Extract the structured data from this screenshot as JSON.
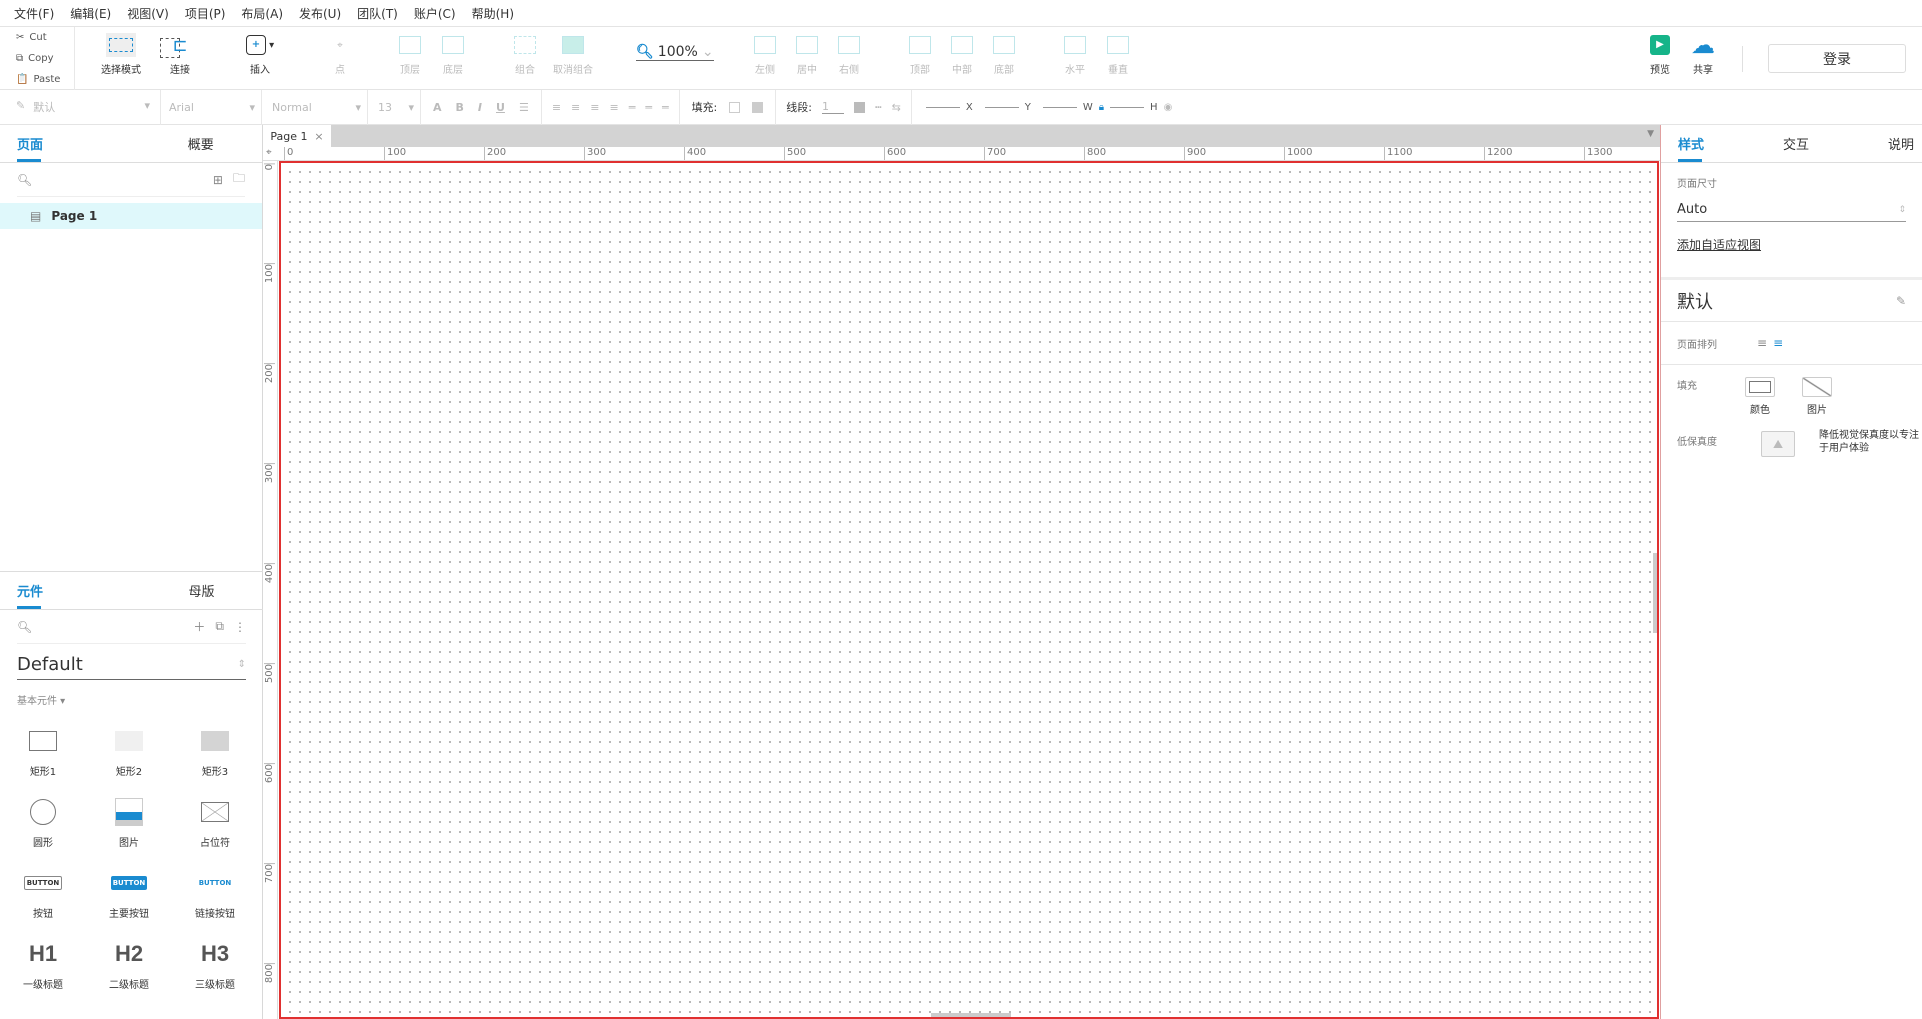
{
  "menu": [
    "文件(F)",
    "编辑(E)",
    "视图(V)",
    "项目(P)",
    "布局(A)",
    "发布(U)",
    "团队(T)",
    "账户(C)",
    "帮助(H)"
  ],
  "clipboard": {
    "cut": "Cut",
    "copy": "Copy",
    "paste": "Paste"
  },
  "toolbar": {
    "select_mode": "选择模式",
    "connect": "连接",
    "insert": "插入",
    "point": "点",
    "top_layer": "顶层",
    "bottom_layer": "底层",
    "group": "组合",
    "ungroup": "取消组合",
    "zoom": "100%",
    "align_left": "左侧",
    "align_center": "居中",
    "align_right": "右侧",
    "align_top": "顶部",
    "align_middle": "中部",
    "align_bottom": "底部",
    "dist_h": "水平",
    "dist_v": "垂直",
    "preview": "预览",
    "share": "共享",
    "login": "登录"
  },
  "format": {
    "style": "默认",
    "font": "Arial",
    "weight": "Normal",
    "size": "13",
    "fill_label": "填充:",
    "stroke_label": "线段:",
    "stroke_value": "1",
    "x": "X",
    "y": "Y",
    "w": "W",
    "h": "H"
  },
  "left": {
    "tabs": [
      "页面",
      "概要"
    ],
    "pages": [
      "Page 1"
    ],
    "widget_tabs": [
      "元件",
      "母版"
    ],
    "library": "Default",
    "category": "基本元件 ▾",
    "widgets": [
      {
        "label": "矩形1",
        "icon": "rect1"
      },
      {
        "label": "矩形2",
        "icon": "rect2"
      },
      {
        "label": "矩形3",
        "icon": "rect3"
      },
      {
        "label": "圆形",
        "icon": "circle"
      },
      {
        "label": "图片",
        "icon": "image"
      },
      {
        "label": "占位符",
        "icon": "placeholder"
      },
      {
        "label": "按钮",
        "icon": "button",
        "text": "BUTTON"
      },
      {
        "label": "主要按钮",
        "icon": "primary-button",
        "text": "BUTTON"
      },
      {
        "label": "链接按钮",
        "icon": "link-button",
        "text": "BUTTON"
      },
      {
        "label": "一级标题",
        "icon": "h1",
        "text": "H1"
      },
      {
        "label": "二级标题",
        "icon": "h2",
        "text": "H2"
      },
      {
        "label": "三级标题",
        "icon": "h3",
        "text": "H3"
      }
    ]
  },
  "doc_tab": "Page 1",
  "ruler": {
    "h": [
      "0",
      "100",
      "200",
      "300",
      "400",
      "500",
      "600",
      "700",
      "800",
      "900",
      "1000",
      "1100",
      "1200",
      "1300"
    ],
    "v": [
      "0",
      "100",
      "200",
      "300",
      "400",
      "500",
      "600",
      "700",
      "800"
    ]
  },
  "right": {
    "tabs": [
      "样式",
      "交互",
      "说明"
    ],
    "page_size_label": "页面尺寸",
    "page_size": "Auto",
    "add_adaptive": "添加自适应视图",
    "style_name": "默认",
    "align_label": "页面排列",
    "fill_label": "填充",
    "fill_color": "颜色",
    "fill_image": "图片",
    "lowfi_label": "低保真度",
    "lowfi_desc": "降低视觉保真度以专注于用户体验"
  },
  "colors": {
    "accent": "#1a8bd0",
    "selection_border": "#e03030",
    "preview": "#16b489"
  }
}
